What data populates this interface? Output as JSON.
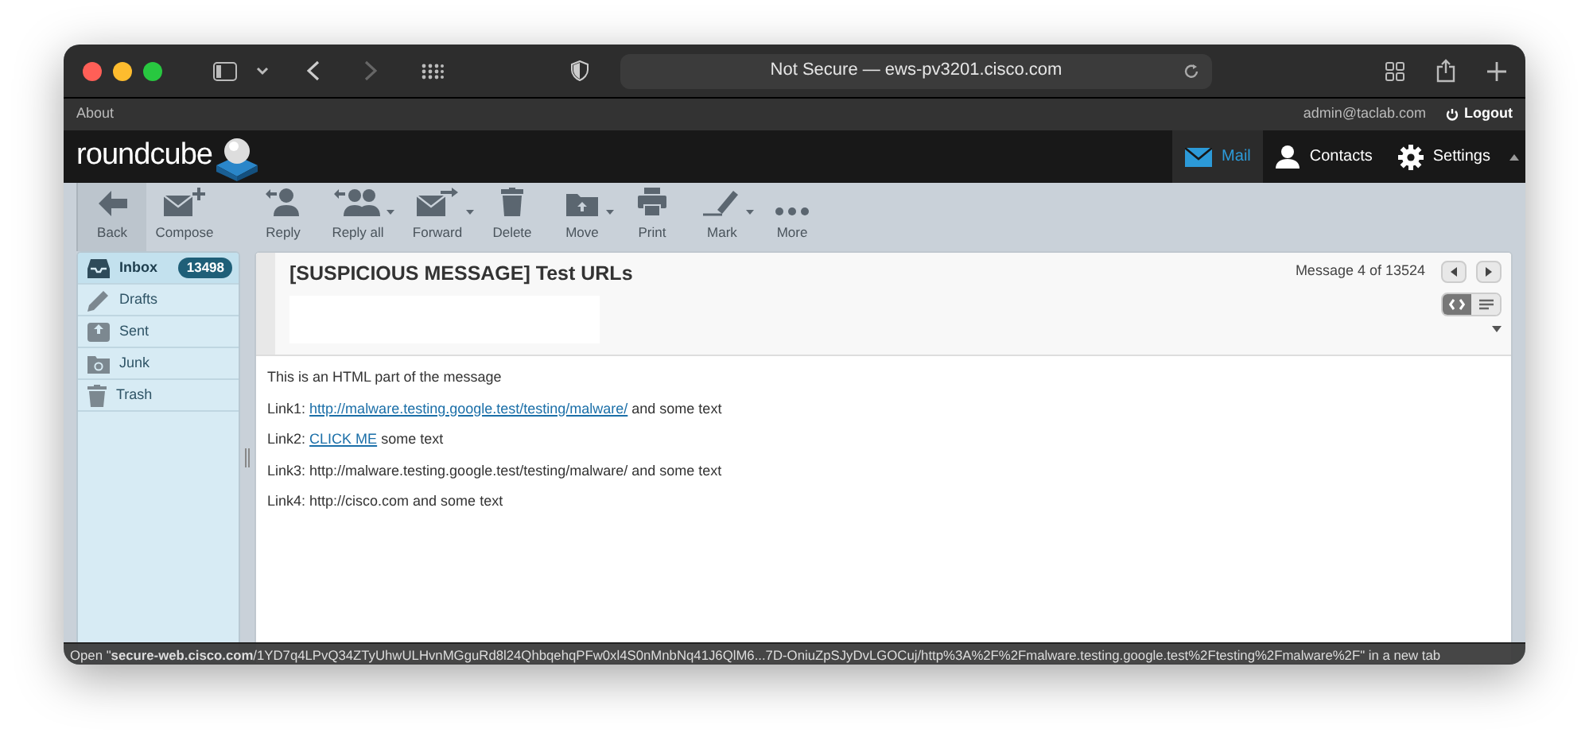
{
  "browser": {
    "address": "Not Secure — ews-pv3201.cisco.com"
  },
  "top_bar": {
    "about": "About",
    "user": "admin@taclab.com",
    "logout": "Logout"
  },
  "header": {
    "logo": "roundcube",
    "nav": [
      {
        "label": "Mail",
        "selected": true
      },
      {
        "label": "Contacts",
        "selected": false
      },
      {
        "label": "Settings",
        "selected": false
      }
    ]
  },
  "toolbar": [
    {
      "label": "Back",
      "dropdown": false,
      "selected": true
    },
    {
      "label": "Compose",
      "dropdown": false,
      "selected": false
    },
    {
      "label": "Reply",
      "dropdown": false,
      "selected": false
    },
    {
      "label": "Reply all",
      "dropdown": true,
      "selected": false
    },
    {
      "label": "Forward",
      "dropdown": true,
      "selected": false
    },
    {
      "label": "Delete",
      "dropdown": false,
      "selected": false
    },
    {
      "label": "Move",
      "dropdown": true,
      "selected": false
    },
    {
      "label": "Print",
      "dropdown": false,
      "selected": false
    },
    {
      "label": "Mark",
      "dropdown": true,
      "selected": false
    },
    {
      "label": "More",
      "dropdown": false,
      "selected": false
    }
  ],
  "folders": [
    {
      "label": "Inbox",
      "selected": true,
      "count": "13498"
    },
    {
      "label": "Drafts",
      "selected": false
    },
    {
      "label": "Sent",
      "selected": false
    },
    {
      "label": "Junk",
      "selected": false
    },
    {
      "label": "Trash",
      "selected": false
    }
  ],
  "message": {
    "subject": "[SUSPICIOUS MESSAGE] Test URLs",
    "position": "Message 4 of 13524",
    "view_modes": [
      {
        "kind": "html",
        "selected": true
      },
      {
        "kind": "plain",
        "selected": false
      }
    ],
    "lines": [
      {
        "text": "This is an HTML part of the message"
      },
      {
        "text": "Link1:",
        "link": "http://malware.testing.google.test/testing/malware/",
        "after": "and some text"
      },
      {
        "text": "Link2:",
        "link": "CLICK ME",
        "after": "some text"
      },
      {
        "text": "Link3: http://malware.testing.google.test/testing/malware/ and some text"
      },
      {
        "text": "Link4: http://cisco.com and some text"
      }
    ]
  },
  "status_bar": "Open \"**secure-web.cisco.com**/1YD7q4LPvQ34ZTyUhwULHvnMGguRd8l24QhbqehqPFw0xl4S0nMnbNq41J6QlM6...7D-OniuZpSJyDvLGOCuj/http%3A%2F%2Fmalware.testing.google.test%2Ftesting%2Fmalware%2F\" in a new tab"
}
